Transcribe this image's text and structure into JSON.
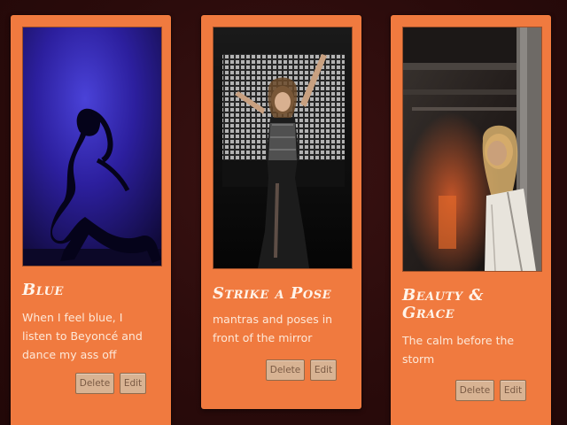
{
  "cards": [
    {
      "title": "Blue",
      "description": "When I feel blue, I listen to Beyoncé and dance my ass off",
      "delete_label": "Delete",
      "edit_label": "Edit",
      "image": "blue-stage-silhouette"
    },
    {
      "title": "Strike a Pose",
      "description": "mantras and poses in front of the mirror",
      "delete_label": "Delete",
      "edit_label": "Edit",
      "image": "black-white-stage-pose"
    },
    {
      "title": "Beauty & Grace",
      "description": "The calm before the storm",
      "delete_label": "Delete",
      "edit_label": "Edit",
      "image": "backstage-portrait"
    }
  ],
  "colors": {
    "background": "#2b0c0c",
    "card": "#f07a3f",
    "title_text": "#fff4ea",
    "button": "#d8b393"
  }
}
